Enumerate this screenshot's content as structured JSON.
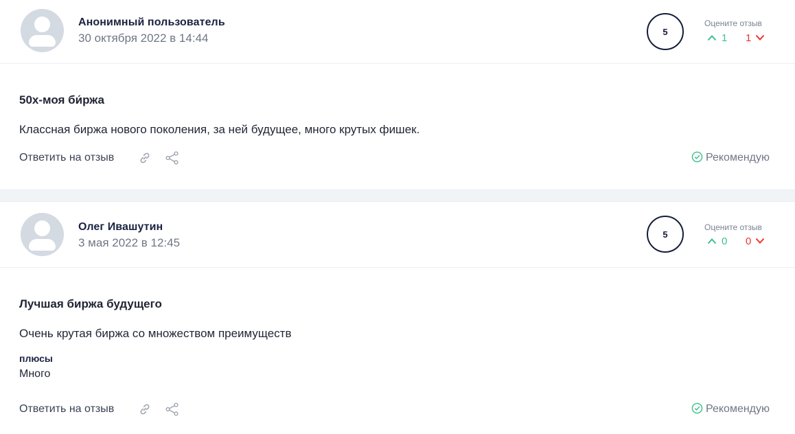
{
  "reviews": [
    {
      "author": "Анонимный пользователь",
      "date": "30 октября 2022 в 14:44",
      "rating": "5",
      "rate_label": "Оцените отзыв",
      "votes_up": "1",
      "votes_down": "1",
      "title": "50х-моя би́ржа",
      "text": "Классная биржа нового поколения, за ней будущее, много крутых фишек.",
      "reply_label": "Ответить на отзыв",
      "recommend_label": "Рекомендую"
    },
    {
      "author": "Олег Ивашутин",
      "date": "3 мая 2022 в 12:45",
      "rating": "5",
      "rate_label": "Оцените отзыв",
      "votes_up": "0",
      "votes_down": "0",
      "title": "Лучшая биржа будущего",
      "text": "Очень крутая биржа со множеством преимуществ",
      "pros_label": "плюсы",
      "pros_text": "Много",
      "reply_label": "Ответить на отзыв",
      "recommend_label": "Рекомендую"
    }
  ],
  "colors": {
    "vote_up": "#3bbf8d",
    "vote_down": "#e8352e",
    "rating_border": "#141c3a",
    "separator": "#f1f4f7"
  },
  "icons": {
    "avatar": "user-avatar-icon",
    "up": "chevron-up-icon",
    "down": "chevron-down-icon",
    "link": "link-icon",
    "share": "share-icon",
    "recommend": "check-circle-icon"
  }
}
